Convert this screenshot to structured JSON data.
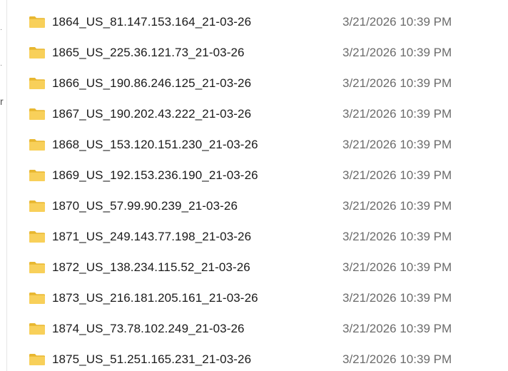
{
  "left_pane": {
    "glyph_r": "r"
  },
  "files": [
    {
      "name": "1864_US_81.147.153.164_21-03-26",
      "date": "3/21/2026 10:39 PM",
      "icon": "folder-icon"
    },
    {
      "name": "1865_US_225.36.121.73_21-03-26",
      "date": "3/21/2026 10:39 PM",
      "icon": "folder-icon"
    },
    {
      "name": "1866_US_190.86.246.125_21-03-26",
      "date": "3/21/2026 10:39 PM",
      "icon": "folder-icon"
    },
    {
      "name": "1867_US_190.202.43.222_21-03-26",
      "date": "3/21/2026 10:39 PM",
      "icon": "folder-icon"
    },
    {
      "name": "1868_US_153.120.151.230_21-03-26",
      "date": "3/21/2026 10:39 PM",
      "icon": "folder-icon"
    },
    {
      "name": "1869_US_192.153.236.190_21-03-26",
      "date": "3/21/2026 10:39 PM",
      "icon": "folder-icon"
    },
    {
      "name": "1870_US_57.99.90.239_21-03-26",
      "date": "3/21/2026 10:39 PM",
      "icon": "folder-icon"
    },
    {
      "name": "1871_US_249.143.77.198_21-03-26",
      "date": "3/21/2026 10:39 PM",
      "icon": "folder-icon"
    },
    {
      "name": "1872_US_138.234.115.52_21-03-26",
      "date": "3/21/2026 10:39 PM",
      "icon": "folder-icon"
    },
    {
      "name": "1873_US_216.181.205.161_21-03-26",
      "date": "3/21/2026 10:39 PM",
      "icon": "folder-icon"
    },
    {
      "name": "1874_US_73.78.102.249_21-03-26",
      "date": "3/21/2026 10:39 PM",
      "icon": "folder-icon"
    },
    {
      "name": "1875_US_51.251.165.231_21-03-26",
      "date": "3/21/2026 10:39 PM",
      "icon": "folder-icon"
    }
  ],
  "colors": {
    "folder_back": "#e8b730",
    "folder_front": "#f8d05a",
    "name_text": "#1a1a1a",
    "date_text": "#6b6b6b"
  }
}
